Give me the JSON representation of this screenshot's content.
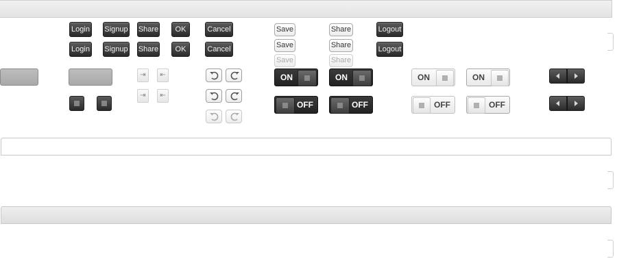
{
  "buttons": {
    "login": "Login",
    "signup": "Signup",
    "share": "Share",
    "ok": "OK",
    "cancel": "Cancel",
    "save": "Save",
    "logout": "Logout"
  },
  "toggles": {
    "on": "ON",
    "off": "OFF"
  },
  "icons": {
    "tab_forward": "tab-to-end-icon",
    "tab_back": "tab-to-start-icon",
    "undo": "undo-icon",
    "redo": "redo-icon",
    "grip": "grip-dots-icon",
    "prev": "triangle-left-icon",
    "next": "triangle-right-icon"
  },
  "colors": {
    "dark_button": "#2a2a2a",
    "light_button": "#ececec",
    "panel_border": "#c9c9c9"
  }
}
